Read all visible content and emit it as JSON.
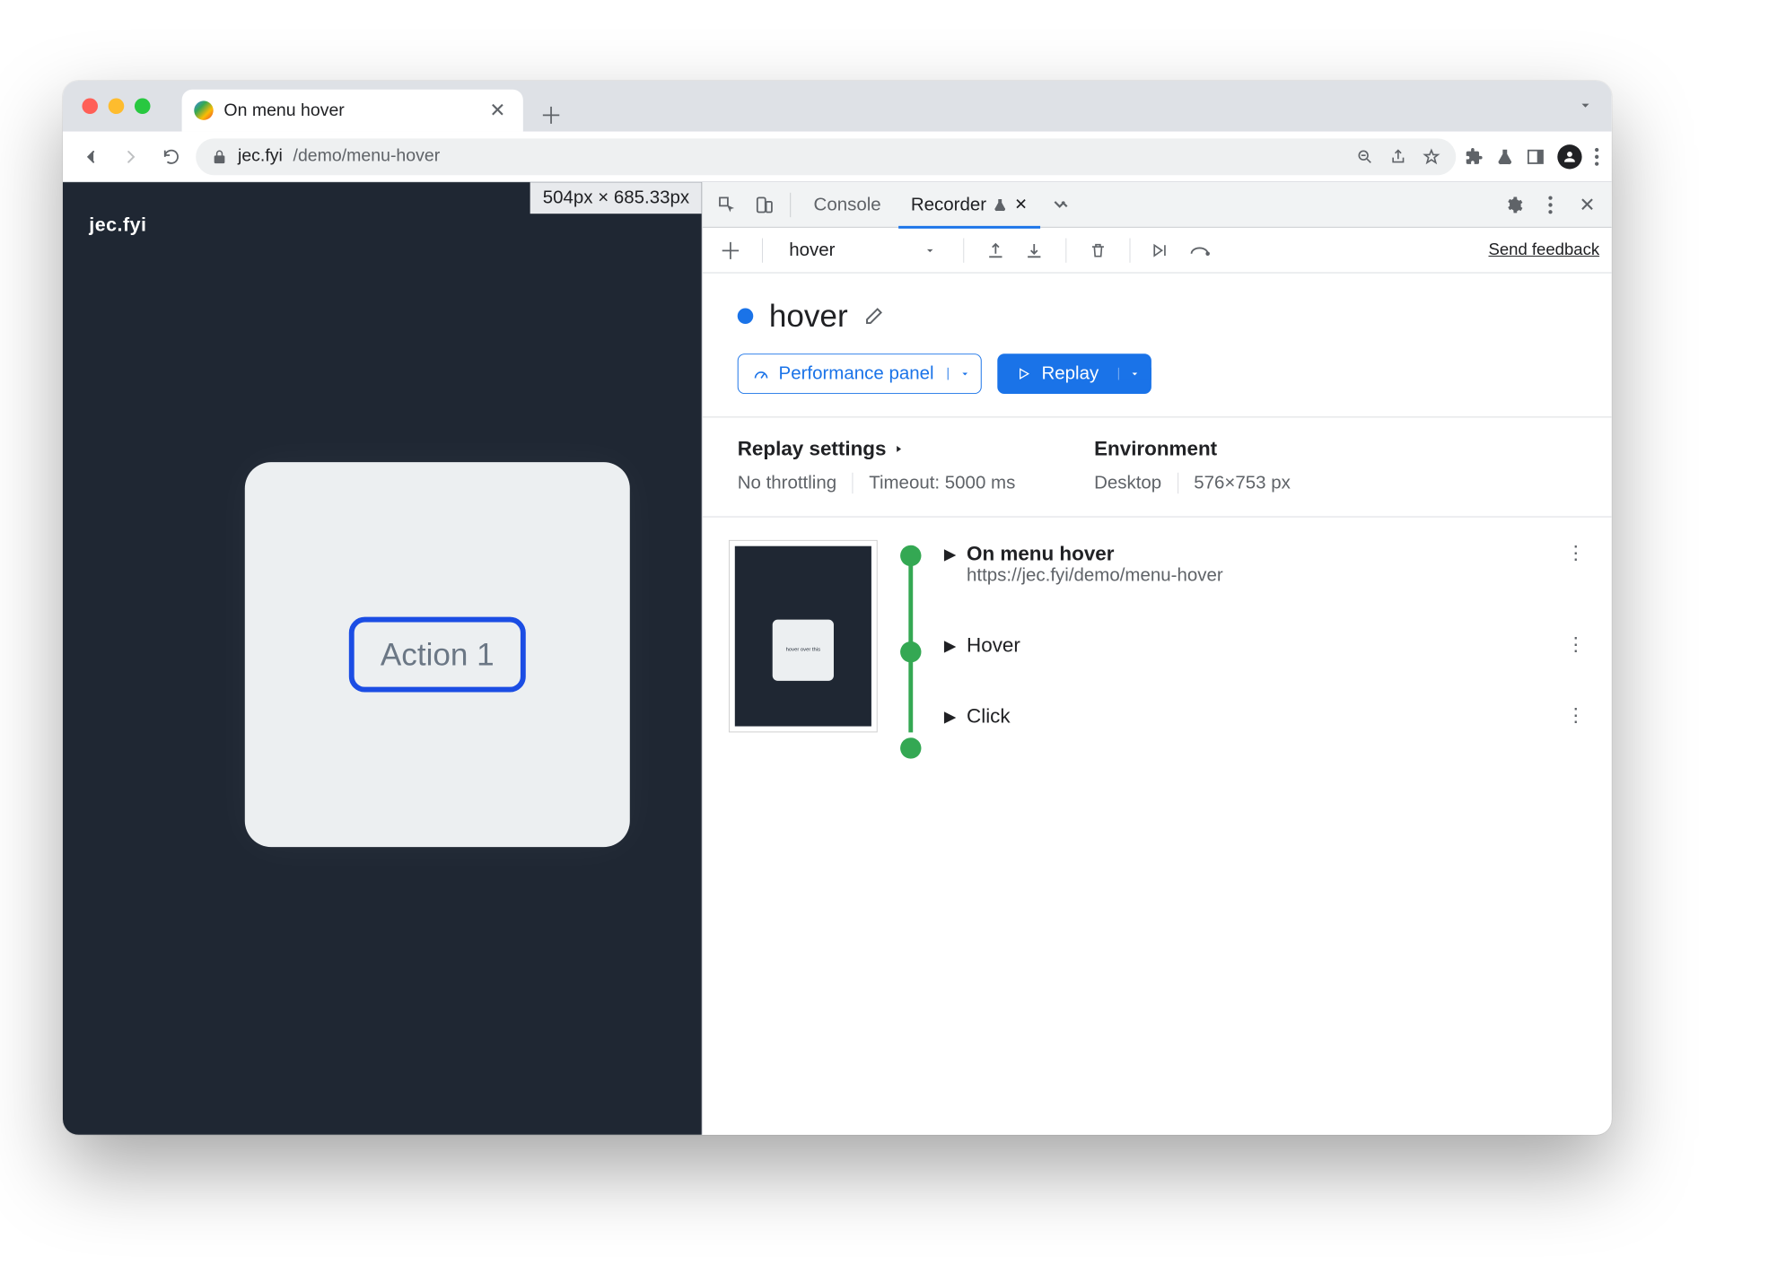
{
  "browser": {
    "tab_title": "On menu hover",
    "url_host": "jec.fyi",
    "url_path": "/demo/menu-hover"
  },
  "page": {
    "brand": "jec.fyi",
    "dimensions_badge": "504px × 685.33px",
    "action_button": "Action 1"
  },
  "devtools": {
    "tabs": {
      "console": "Console",
      "recorder": "Recorder"
    },
    "rec_toolbar": {
      "recording_name": "hover",
      "feedback": "Send feedback"
    },
    "flow": {
      "title": "hover",
      "perf_button": "Performance panel",
      "replay_button": "Replay"
    },
    "settings": {
      "replay_heading": "Replay settings",
      "throttling": "No throttling",
      "timeout": "Timeout: 5000 ms",
      "env_heading": "Environment",
      "device": "Desktop",
      "viewport": "576×753 px"
    },
    "steps": {
      "s1_title": "On menu hover",
      "s1_sub": "https://jec.fyi/demo/menu-hover",
      "s2_title": "Hover",
      "s3_title": "Click"
    }
  }
}
